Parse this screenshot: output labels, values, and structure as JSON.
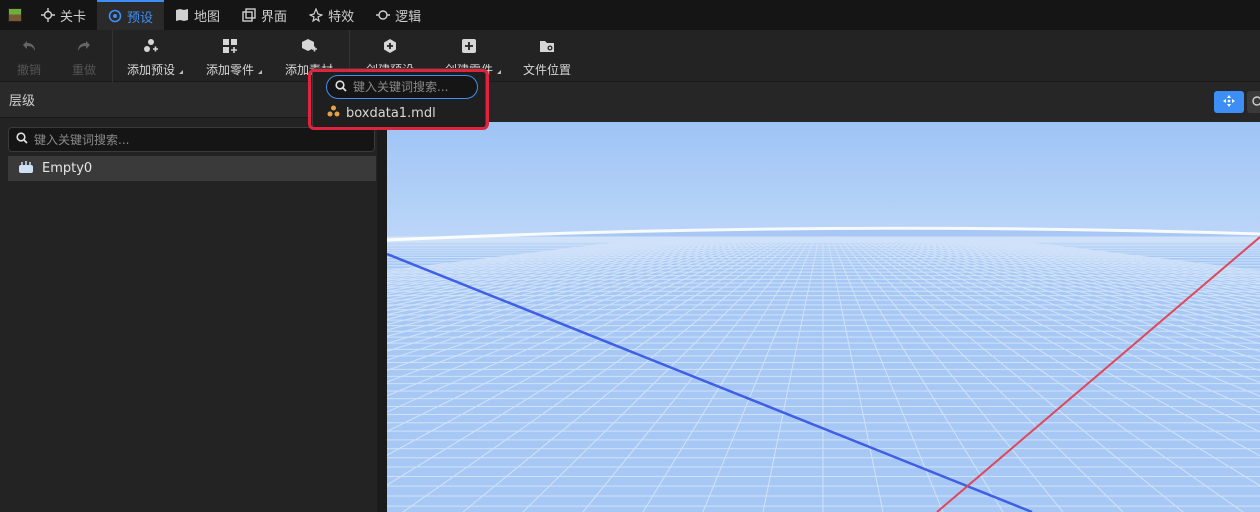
{
  "tabs": [
    {
      "label": "关卡",
      "icon": "crosshair-icon"
    },
    {
      "label": "预设",
      "icon": "gear-icon",
      "active": true
    },
    {
      "label": "地图",
      "icon": "map-icon"
    },
    {
      "label": "界面",
      "icon": "window-icon"
    },
    {
      "label": "特效",
      "icon": "effects-icon"
    },
    {
      "label": "逻辑",
      "icon": "logic-icon"
    }
  ],
  "toolbar": {
    "undo": "撤销",
    "redo": "重做",
    "add_preset": "添加预设",
    "add_part": "添加零件",
    "add_material": "添加素材",
    "create_preset": "创建预设",
    "create_part": "创建零件",
    "file_location": "文件位置"
  },
  "left_panel": {
    "title": "层级",
    "search_placeholder": "键入关键词搜索...",
    "tree_items": [
      "Empty0"
    ]
  },
  "popup": {
    "search_placeholder": "键入关键词搜索...",
    "items": [
      "boxdata1.mdl"
    ]
  },
  "colors": {
    "accent": "#3d8ff5",
    "highlight": "#e0243d",
    "sky_top": "#9ec4f5",
    "grid": "#b9d3f7"
  }
}
